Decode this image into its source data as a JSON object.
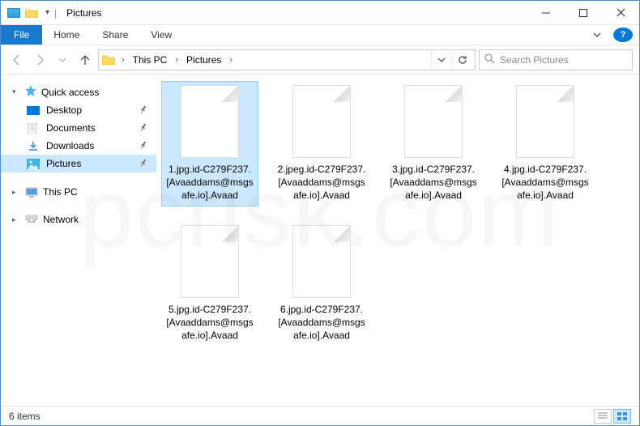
{
  "titlebar": {
    "title": "Pictures"
  },
  "menu": {
    "file": "File",
    "tabs": [
      "Home",
      "Share",
      "View"
    ]
  },
  "breadcrumb": {
    "segments": [
      "This PC",
      "Pictures"
    ]
  },
  "search": {
    "placeholder": "Search Pictures"
  },
  "sidebar": {
    "quick_access": "Quick access",
    "items": [
      {
        "label": "Desktop",
        "pinned": true
      },
      {
        "label": "Documents",
        "pinned": true
      },
      {
        "label": "Downloads",
        "pinned": true
      },
      {
        "label": "Pictures",
        "pinned": true,
        "selected": true
      }
    ],
    "this_pc": "This PC",
    "network": "Network"
  },
  "files": [
    {
      "name": "1.jpg.id-C279F237.[Avaaddams@msgsafe.io].Avaad",
      "selected": true
    },
    {
      "name": "2.jpeg.id-C279F237.[Avaaddams@msgsafe.io].Avaad"
    },
    {
      "name": "3.jpg.id-C279F237.[Avaaddams@msgsafe.io].Avaad"
    },
    {
      "name": "4.jpg.id-C279F237.[Avaaddams@msgsafe.io].Avaad"
    },
    {
      "name": "5.jpg.id-C279F237.[Avaaddams@msgsafe.io].Avaad"
    },
    {
      "name": "6.jpg.id-C279F237.[Avaaddams@msgsafe.io].Avaad"
    }
  ],
  "status": {
    "count_label": "6 items"
  }
}
